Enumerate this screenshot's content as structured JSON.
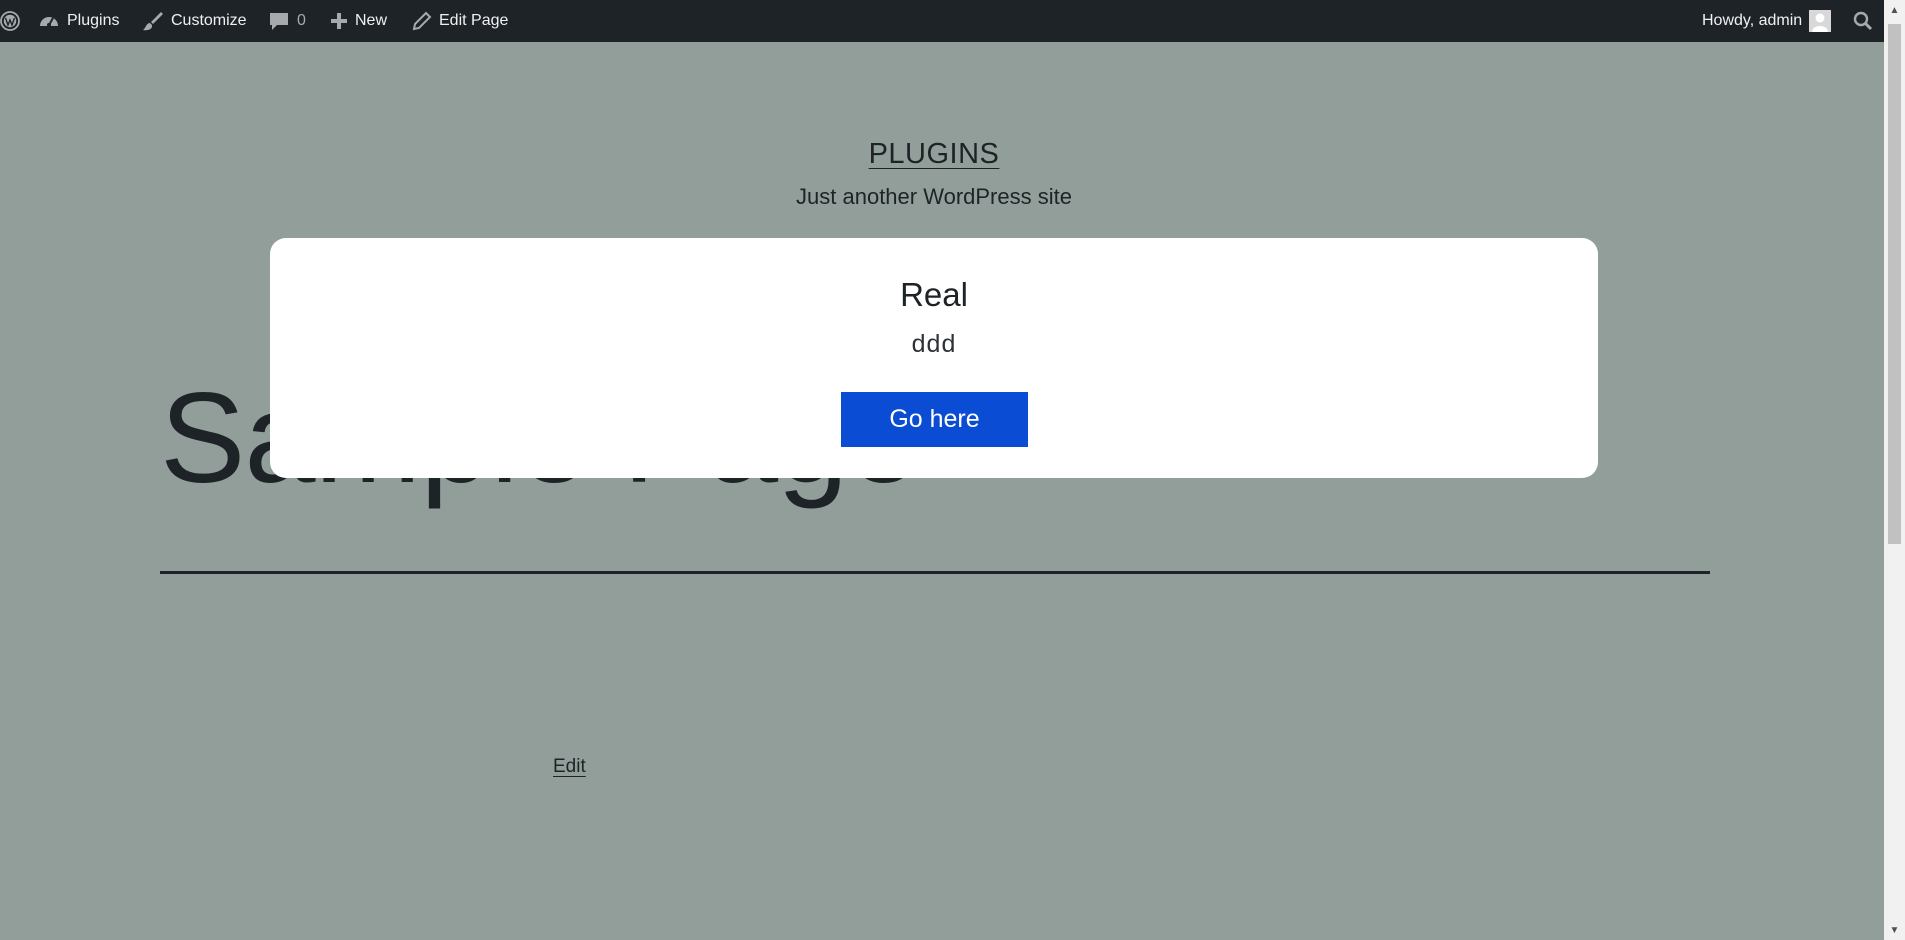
{
  "adminbar": {
    "site_name": "Plugins",
    "customize_label": "Customize",
    "comments_count": "0",
    "new_label": "New",
    "edit_page_label": "Edit Page",
    "greeting": "Howdy, admin",
    "icons": [
      "wordpress-logo",
      "dashboard-icon",
      "brush-icon",
      "comment-icon",
      "plus-icon",
      "pencil-icon",
      "avatar",
      "search-icon"
    ]
  },
  "site": {
    "title": "PLUGINS",
    "tagline": "Just another WordPress site"
  },
  "page": {
    "title": "Sample Page",
    "edit_label": "Edit"
  },
  "modal": {
    "title": "Real",
    "body": "ddd",
    "button_label": "Go here"
  },
  "colors": {
    "background": "#929e99",
    "adminbar": "#1d2327",
    "button": "#0b4cd4",
    "text": "#1e2327"
  }
}
